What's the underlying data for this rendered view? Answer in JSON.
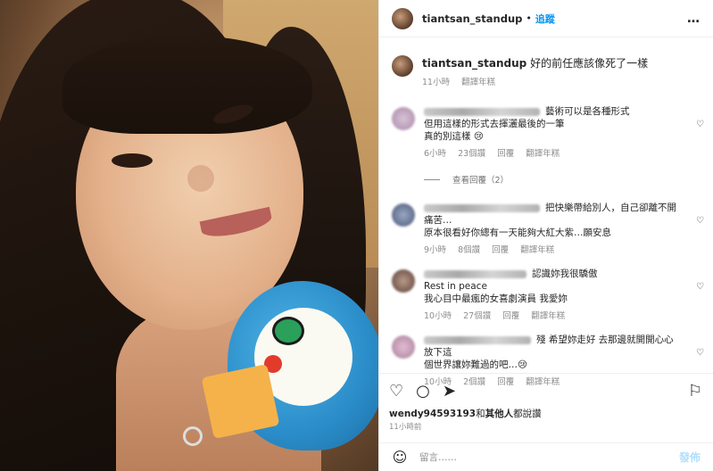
{
  "header": {
    "username": "tiantsan_standup",
    "separator": "•",
    "follow_label": "追蹤",
    "more_icon": "…"
  },
  "caption": {
    "username": "tiantsan_standup",
    "text": "好的前任應該像死了一樣",
    "time": "11小時",
    "translate": "翻譯年糕"
  },
  "comments": [
    {
      "lines": [
        "藝術可以是各種形式",
        "但用這樣的形式去揮灑最後的一筆",
        "真的別這樣 😢"
      ],
      "time": "6小時",
      "likes": "23個讚",
      "reply": "回覆",
      "translate": "翻譯年糕",
      "view_replies": "查看回覆（2）"
    },
    {
      "lines": [
        "把快樂帶給別人，自己卻離不開痛苦…",
        "原本很看好你總有一天能夠大紅大紫…願安息"
      ],
      "time": "9小時",
      "likes": "8個讚",
      "reply": "回覆",
      "translate": "翻譯年糕"
    },
    {
      "lines": [
        "認識妳我很驕傲",
        "Rest in peace",
        "我心目中最瘋的女喜劇演員 我愛妳"
      ],
      "time": "10小時",
      "likes": "27個讚",
      "reply": "回覆",
      "translate": "翻譯年糕"
    },
    {
      "lines": [
        "殘 希望妳走好 去那邊就開開心心 放下這",
        "個世界讓妳難過的吧…😢"
      ],
      "time": "10小時",
      "likes": "2個讚",
      "reply": "回覆",
      "translate": "翻譯年糕"
    }
  ],
  "actions": {
    "heart_icon": "♡",
    "comment_icon": "○",
    "share_icon": "➤",
    "bookmark_icon": "⚐"
  },
  "likes": {
    "user": "wendy94593193",
    "and": "和",
    "others": "其他人",
    "suffix": "都說讚"
  },
  "post_time": "11小時前",
  "composer": {
    "emoji_icon": "☺",
    "placeholder": "留言……",
    "post_label": "發佈"
  },
  "colors": {
    "accent": "#0095f6",
    "post_disabled": "#b2dffc",
    "meta": "#8e8e8e"
  }
}
